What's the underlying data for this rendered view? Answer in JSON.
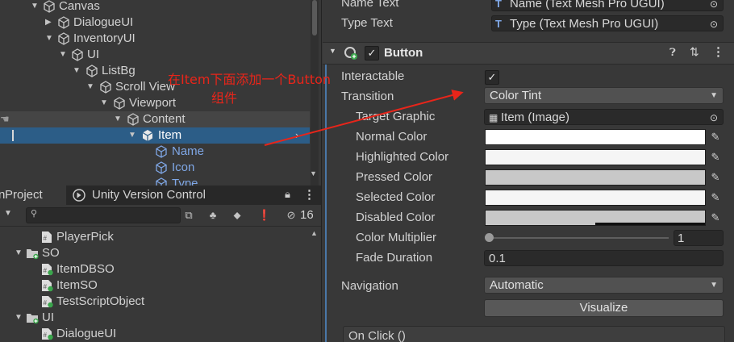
{
  "hierarchy": {
    "items": [
      {
        "label": "Canvas",
        "highlight": false
      },
      {
        "label": "DialogueUI",
        "highlight": false
      },
      {
        "label": "InventoryUI",
        "highlight": false
      },
      {
        "label": "UI",
        "highlight": false
      },
      {
        "label": "ListBg",
        "highlight": false
      },
      {
        "label": "Scroll View",
        "highlight": false
      },
      {
        "label": "Viewport",
        "highlight": false
      },
      {
        "label": "Content",
        "highlight": false
      },
      {
        "label": "Item",
        "highlight": true
      },
      {
        "label": "Name",
        "highlight": false
      },
      {
        "label": "Icon",
        "highlight": false
      },
      {
        "label": "Type",
        "highlight": false
      }
    ]
  },
  "project": {
    "tab_project": "Project",
    "tab_uvc": "Unity Version Control",
    "hidden_count": "16",
    "items": [
      {
        "label": "PlayerPick"
      },
      {
        "label": "SO"
      },
      {
        "label": "ItemDBSO"
      },
      {
        "label": "ItemSO"
      },
      {
        "label": "TestScriptObject"
      },
      {
        "label": "UI"
      },
      {
        "label": "DialogueUI"
      }
    ]
  },
  "inspector": {
    "top_rows": [
      {
        "label": "Name Text",
        "value": "Name (Text Mesh Pro UGUI)"
      },
      {
        "label": "Type Text",
        "value": "Type (Text Mesh Pro UGUI)"
      }
    ],
    "component_title": "Button",
    "interactable_label": "Interactable",
    "transition_label": "Transition",
    "transition_value": "Color Tint",
    "target_graphic_label": "Target Graphic",
    "target_graphic_value": "Item (Image)",
    "colors": [
      {
        "label": "Normal Color",
        "hex": "#ffffff"
      },
      {
        "label": "Highlighted Color",
        "hex": "#f5f5f5"
      },
      {
        "label": "Pressed Color",
        "hex": "#c8c8c8"
      },
      {
        "label": "Selected Color",
        "hex": "#f5f5f5"
      },
      {
        "label": "Disabled Color",
        "hex": "#c8c8c8"
      }
    ],
    "color_multiplier_label": "Color Multiplier",
    "color_multiplier_value": "1",
    "fade_duration_label": "Fade Duration",
    "fade_duration_value": "0.1",
    "navigation_label": "Navigation",
    "navigation_value": "Automatic",
    "visualize_label": "Visualize",
    "onclick_label": "On Click ()"
  },
  "annotation": {
    "line1": "在Item下面添加一个Button",
    "line2": "组件",
    "color": "#e8251a"
  }
}
